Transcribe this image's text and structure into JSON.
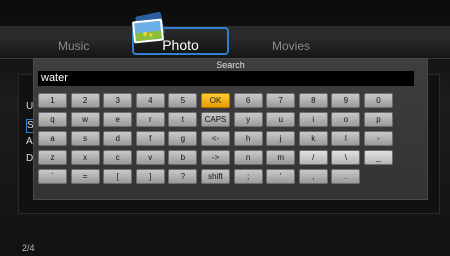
{
  "tabs": {
    "music": "Music",
    "photo": "Photo",
    "movies": "Movies"
  },
  "background": {
    "items": [
      "U",
      "S",
      "A",
      "D"
    ],
    "page_indicator": "2/4"
  },
  "keyboard": {
    "title": "Search",
    "input_value": "water",
    "selected_key": "OK",
    "rows": [
      [
        "1",
        "2",
        "3",
        "4",
        "5",
        "OK",
        "6",
        "7",
        "8",
        "9",
        "0"
      ],
      [
        "q",
        "w",
        "e",
        "r",
        "t",
        "CAPS",
        "y",
        "u",
        "i",
        "o",
        "p"
      ],
      [
        "a",
        "s",
        "d",
        "f",
        "g",
        "<-",
        "h",
        "j",
        "k",
        "l",
        "-"
      ],
      [
        "z",
        "x",
        "c",
        "v",
        "b",
        "->",
        "n",
        "m",
        "/",
        "\\",
        "_"
      ],
      [
        "`",
        "=",
        "[",
        "]",
        "?",
        "shift",
        ";",
        "'",
        ",",
        "."
      ]
    ]
  },
  "colors": {
    "selected_key": "#f2b21e",
    "focus_border": "#2f7fd0"
  }
}
